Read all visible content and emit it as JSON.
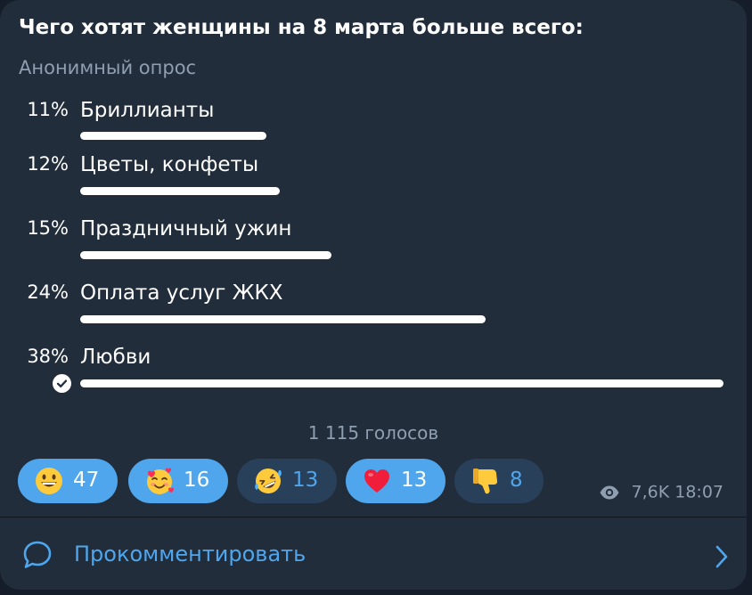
{
  "poll": {
    "question": "Чего хотят женщины на 8 марта больше всего:",
    "type_label": "Анонимный опрос",
    "options": [
      {
        "percent_label": "11%",
        "label": "Бриллианты",
        "percent": 11,
        "bar_fraction": 0.29,
        "chosen": false
      },
      {
        "percent_label": "12%",
        "label": "Цветы, конфеты",
        "percent": 12,
        "bar_fraction": 0.31,
        "chosen": false
      },
      {
        "percent_label": "15%",
        "label": "Праздничный ужин",
        "percent": 15,
        "bar_fraction": 0.39,
        "chosen": false
      },
      {
        "percent_label": "24%",
        "label": "Оплата услуг ЖКХ",
        "percent": 24,
        "bar_fraction": 0.63,
        "chosen": false
      },
      {
        "percent_label": "38%",
        "label": "Любви",
        "percent": 38,
        "bar_fraction": 1.0,
        "chosen": true
      }
    ],
    "total_votes": "1 115 голосов"
  },
  "reactions": [
    {
      "emoji": "grinning-face",
      "count": "47",
      "selected": true
    },
    {
      "emoji": "smiling-face-with-hearts",
      "count": "16",
      "selected": true
    },
    {
      "emoji": "rolling-on-floor-laughing",
      "count": "13",
      "selected": false
    },
    {
      "emoji": "red-heart",
      "count": "13",
      "selected": true
    },
    {
      "emoji": "thumbs-down",
      "count": "8",
      "selected": false
    }
  ],
  "meta": {
    "views": "7,6K",
    "time": "18:07"
  },
  "comment": {
    "label": "Прокомментировать"
  },
  "colors": {
    "page_bg": "#141d29",
    "card_bg": "#212d3b",
    "accent": "#4fa6ed",
    "muted_text": "#8f9eb0",
    "reaction_off_bg": "#29405a"
  }
}
